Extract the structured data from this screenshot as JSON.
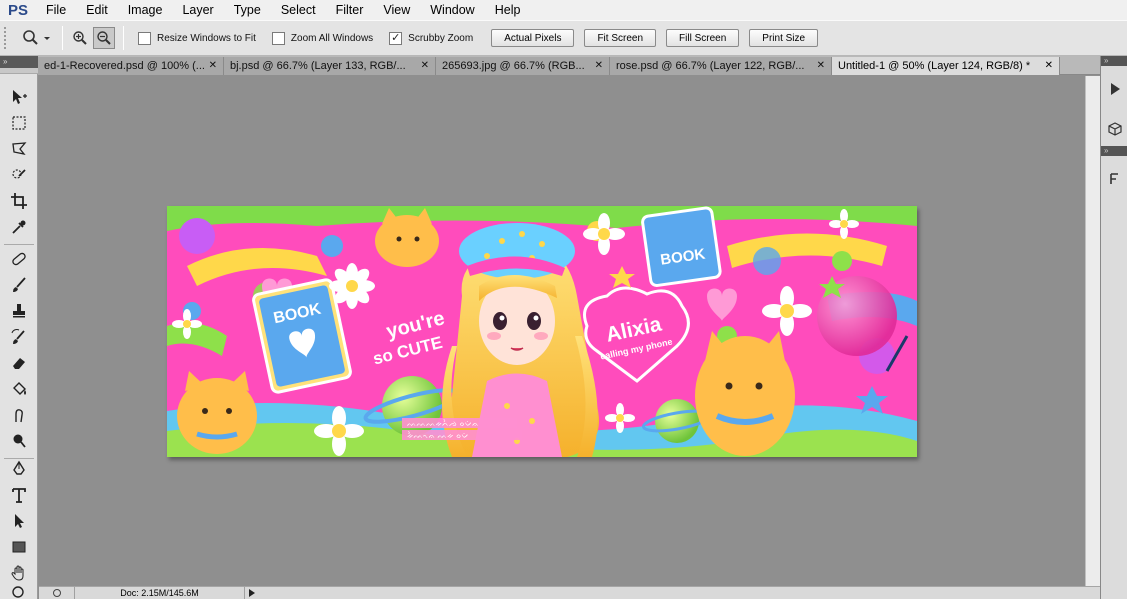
{
  "app": {
    "logo": "PS"
  },
  "menu": [
    "File",
    "Edit",
    "Image",
    "Layer",
    "Type",
    "Select",
    "Filter",
    "View",
    "Window",
    "Help"
  ],
  "options": {
    "tool_icon": "zoom-icon",
    "resize_windows": {
      "label": "Resize Windows to Fit",
      "checked": false
    },
    "zoom_all": {
      "label": "Zoom All Windows",
      "checked": false
    },
    "scrubby_zoom": {
      "label": "Scrubby Zoom",
      "checked": true
    },
    "buttons": [
      "Actual Pixels",
      "Fit Screen",
      "Fill Screen",
      "Print Size"
    ]
  },
  "tabs": [
    {
      "label": "ed-1-Recovered.psd @ 100% (...",
      "active": false
    },
    {
      "label": "bj.psd @ 66.7% (Layer 133, RGB/...",
      "active": false
    },
    {
      "label": "265693.jpg @ 66.7% (RGB...",
      "active": false
    },
    {
      "label": "rose.psd @ 66.7% (Layer 122, RGB/...",
      "active": false
    },
    {
      "label": "Untitled-1 @ 50% (Layer 124, RGB/8) *",
      "active": true
    }
  ],
  "tools": [
    "move-icon",
    "marquee-icon",
    "lasso-icon",
    "quick-select-icon",
    "crop-icon",
    "eyedropper-icon",
    "healing-icon",
    "brush-icon",
    "stamp-icon",
    "history-brush-icon",
    "eraser-icon",
    "paint-bucket-icon",
    "smudge-icon",
    "dodge-icon",
    "pen-icon",
    "type-icon",
    "path-select-icon",
    "rectangle-icon",
    "hand-icon",
    "zoom-tool-icon"
  ],
  "artwork": {
    "book_text": "BOOK",
    "book_text_2": "BOOK",
    "tagline": "you're",
    "tagline_2": "so CUTE",
    "name": "Alixia",
    "subtitle": "calling my phone",
    "small_text_1": "ᨓᨓᨓᨀᨈᨛᨌ ᨔᨆᨗᨊ",
    "small_text_2": "ᨀᨛᨓᨚᨊ ᨓᨀ ᨔᨆᨗ"
  },
  "status": {
    "doc": "Doc: 2.15M/145.6M"
  },
  "colors": {
    "pink": "#ff3fb4",
    "yellow": "#ffd84a",
    "green": "#8ee04a",
    "blue": "#5aa8ee"
  }
}
